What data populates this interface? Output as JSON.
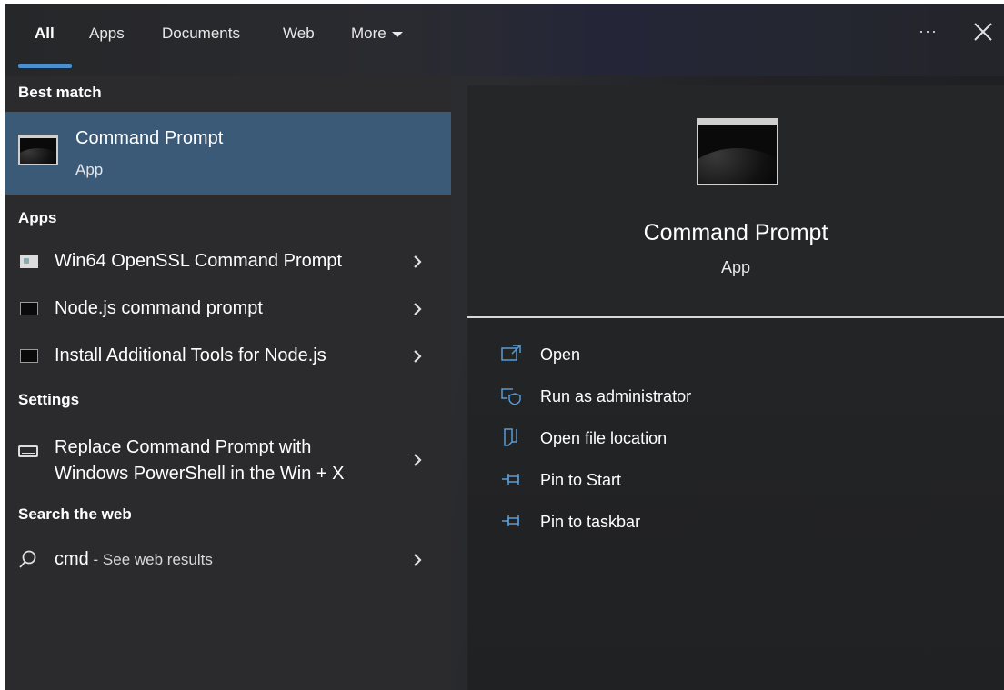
{
  "tabs": {
    "all": "All",
    "apps": "Apps",
    "documents": "Documents",
    "web": "Web",
    "more": "More"
  },
  "toolbar": {
    "ellipsis": "···",
    "close_icon": "close-icon"
  },
  "colors": {
    "accent_underline": "#4a90d0",
    "selected_row": "#3a5a78"
  },
  "results": {
    "best_match_header": "Best match",
    "best_match": {
      "title": "Command Prompt",
      "type": "App"
    },
    "apps_header": "Apps",
    "apps": [
      {
        "label": "Win64 OpenSSL Command Prompt",
        "icon": "openssl-icon"
      },
      {
        "label": "Node.js command prompt",
        "icon": "console-icon"
      },
      {
        "label": "Install Additional Tools for Node.js",
        "icon": "console-icon"
      }
    ],
    "settings_header": "Settings",
    "settings": [
      {
        "line1": "Replace Command Prompt with",
        "line2": "Windows PowerShell in the Win + X",
        "icon": "keyboard-icon"
      }
    ],
    "web_header": "Search the web",
    "web": {
      "query": "cmd",
      "suffix": " - See web results",
      "icon": "search-icon"
    }
  },
  "preview": {
    "title": "Command Prompt",
    "type": "App",
    "actions": [
      {
        "label": "Open",
        "icon": "open-icon"
      },
      {
        "label": "Run as administrator",
        "icon": "shield-icon"
      },
      {
        "label": "Open file location",
        "icon": "folder-icon"
      },
      {
        "label": "Pin to Start",
        "icon": "pin-icon"
      },
      {
        "label": "Pin to taskbar",
        "icon": "pin-icon"
      }
    ]
  }
}
